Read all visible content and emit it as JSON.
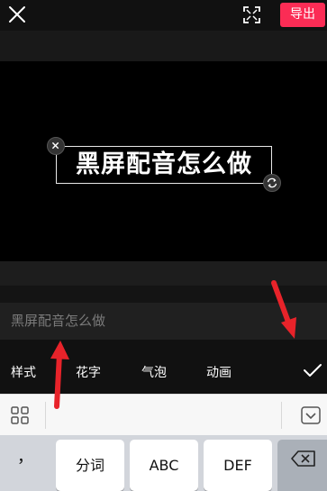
{
  "header": {
    "close_icon": "close-icon",
    "fullscreen_icon": "fullscreen-icon",
    "export_label": "导出",
    "accent": "#fb2c55"
  },
  "preview": {
    "caption": "黑屏配音怎么做",
    "delete_icon": "close-small-icon",
    "rotate_icon": "rotate-scale-icon"
  },
  "editor": {
    "text_value": "黑屏配音怎么做",
    "tabs": [
      {
        "label": "样式"
      },
      {
        "label": "花字"
      },
      {
        "label": "气泡"
      },
      {
        "label": "动画"
      }
    ],
    "confirm_icon": "checkmark-icon"
  },
  "keyboard": {
    "toolbar_icon": "grid-icon",
    "collapse_icon": "chevron-down-icon",
    "keys": {
      "comma": "，",
      "k1": "分词",
      "k2": "ABC",
      "k3": "DEF"
    },
    "delete_icon": "backspace-icon"
  },
  "annotation": {
    "arrow_color": "#e8232a"
  }
}
